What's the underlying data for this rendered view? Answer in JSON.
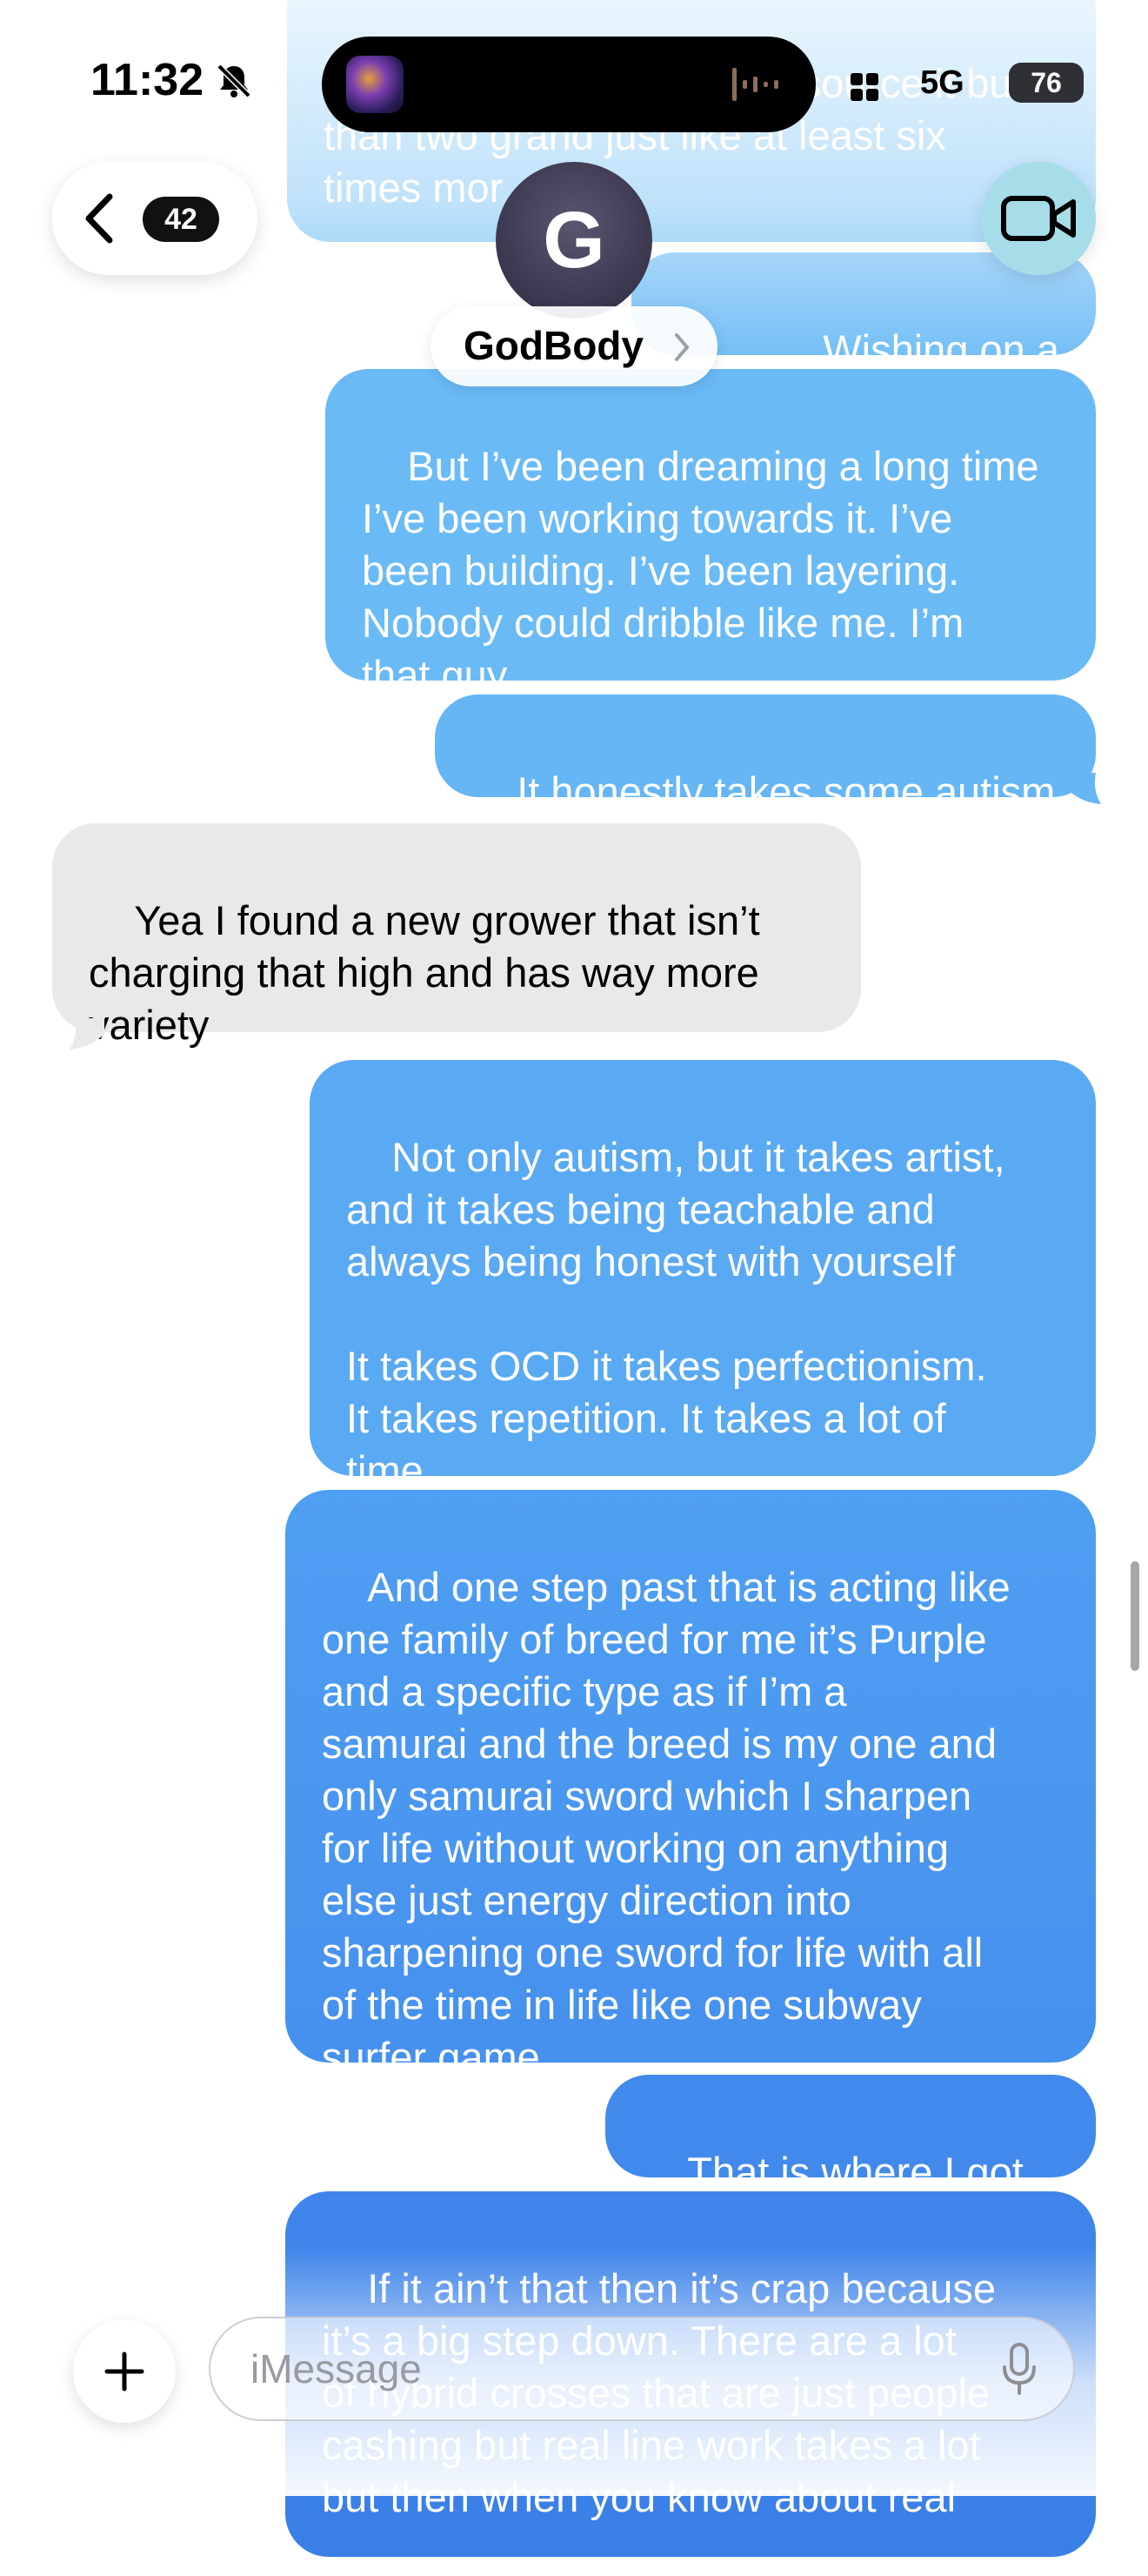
{
  "status_bar": {
    "time": "11:32",
    "network": "5G",
    "battery": "76"
  },
  "nav": {
    "back_count": "42",
    "contact_initial": "G",
    "contact_name": "GodBody"
  },
  "messages": [
    {
      "from": "me",
      "text": "of failing if you try to outsource it but\nthan two grand just like at least six\ntimes mor"
    },
    {
      "from": "me",
      "text": "Wishing on a dream"
    },
    {
      "from": "me",
      "text": "But I’ve been dreaming a long time\nI’ve been working towards it. I’ve\nbeen building. I’ve been layering.\nNobody could dribble like me. I’m\nthat guy."
    },
    {
      "from": "me",
      "text": "It honestly takes some autism"
    },
    {
      "from": "them",
      "text": "Yea I found a new grower that isn’t\ncharging that high and has way more\nvariety"
    },
    {
      "from": "me",
      "text": "Not only autism, but it takes artist,\nand it takes being teachable and\nalways being honest with yourself\n\nIt takes OCD it takes perfectionism.\nIt takes repetition. It takes a lot of\ntime."
    },
    {
      "from": "me",
      "text": "And one step past that is acting like\none family of breed for me it’s Purple\nand a specific type as if I’m a\nsamurai and the breed is my one and\nonly samurai sword which I sharpen\nfor life without working on anything\nelse just energy direction into\nsharpening one sword for life with all\nof the time in life like one subway\nsurfer game"
    },
    {
      "from": "me",
      "text": "That is where I got to"
    },
    {
      "from": "me",
      "text": "If it ain’t that then it’s crap because\nit’s a big step down. There are a lot\nof hybrid crosses that are just people\ncashing but real line work takes a lot\nbut then when you know about real"
    }
  ],
  "composer": {
    "placeholder": "iMessage"
  },
  "colors": {
    "outgoing_top": "#6bbcf7",
    "outgoing_bottom": "#3a7fe6",
    "incoming": "#e9e9eb",
    "accent": "#007aff"
  },
  "icons": [
    "bell-slash-icon",
    "chevron-left-icon",
    "video-camera-icon",
    "plus-icon",
    "microphone-icon",
    "signal-icon"
  ]
}
